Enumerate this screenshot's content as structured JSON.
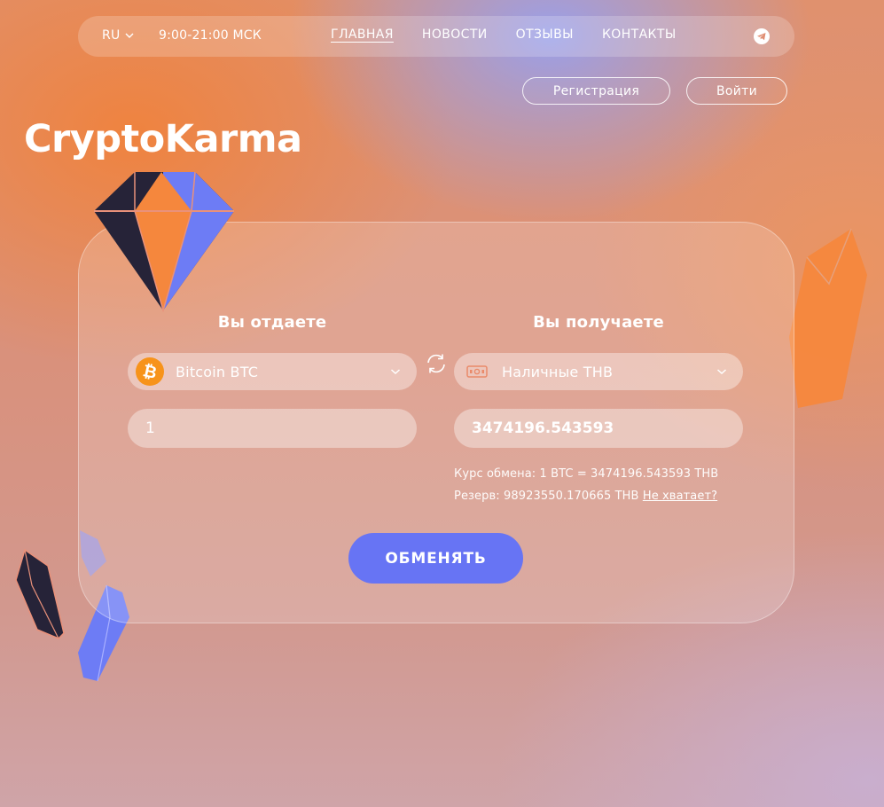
{
  "nav": {
    "language": "RU",
    "hours": "9:00-21:00 МСК",
    "links": [
      {
        "label": "ГЛАВНАЯ",
        "active": true
      },
      {
        "label": "НОВОСТИ",
        "active": false
      },
      {
        "label": "ОТЗЫВЫ",
        "active": false
      },
      {
        "label": "КОНТАКТЫ",
        "active": false
      }
    ],
    "social_icon": "telegram-icon"
  },
  "auth": {
    "register_label": "Регистрация",
    "login_label": "Войти"
  },
  "brand": {
    "logo_text": "CryptoKarma"
  },
  "exchange": {
    "give": {
      "title": "Вы отдаете",
      "currency_label": "Bitcoin BTC",
      "currency_icon": "bitcoin-icon",
      "amount": "1"
    },
    "receive": {
      "title": "Вы получаете",
      "currency_label": "Наличные THB",
      "currency_icon": "cash-icon",
      "amount": "3474196.543593"
    },
    "rate_text": "Курс обмена: 1 BTC = 3474196.543593 THB",
    "reserve_text": "Резерв: 98923550.170665 THB",
    "reserve_link": "Не хватает?",
    "submit_label": "ОБМЕНЯТЬ"
  },
  "colors": {
    "accent": "#6774f4",
    "bitcoin": "#f7931a",
    "crystal_orange": "#f5873d",
    "crystal_blue": "#6d7cf5",
    "crystal_dark": "#262338"
  }
}
